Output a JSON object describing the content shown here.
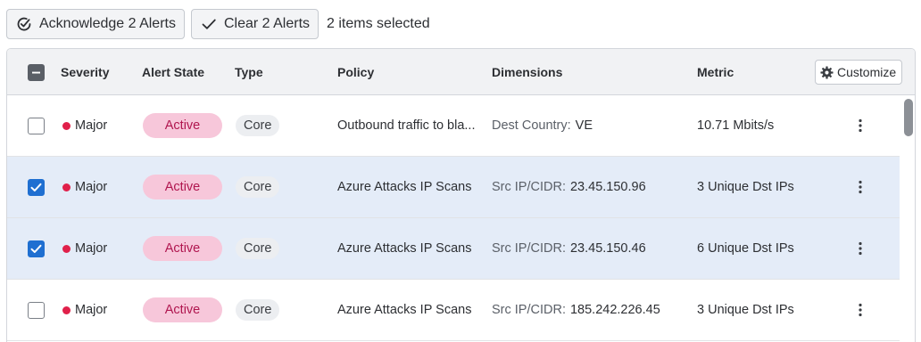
{
  "toolbar": {
    "acknowledge_label": "Acknowledge 2 Alerts",
    "clear_label": "Clear 2 Alerts",
    "selection_text": "2 items selected"
  },
  "table": {
    "columns": {
      "severity": "Severity",
      "alert_state": "Alert State",
      "type": "Type",
      "policy": "Policy",
      "dimensions": "Dimensions",
      "metric": "Metric"
    },
    "customize_label": "Customize",
    "header_checkbox_state": "partial",
    "rows": [
      {
        "selected": false,
        "severity": "Major",
        "state": "Active",
        "type": "Core",
        "policy": "Outbound traffic to bla...",
        "dim_label": "Dest Country:",
        "dim_value": "VE",
        "metric": "10.71 Mbits/s"
      },
      {
        "selected": true,
        "severity": "Major",
        "state": "Active",
        "type": "Core",
        "policy": "Azure Attacks IP Scans",
        "dim_label": "Src IP/CIDR:",
        "dim_value": "23.45.150.96",
        "metric": "3 Unique Dst IPs"
      },
      {
        "selected": true,
        "severity": "Major",
        "state": "Active",
        "type": "Core",
        "policy": "Azure Attacks IP Scans",
        "dim_label": "Src IP/CIDR:",
        "dim_value": "23.45.150.46",
        "metric": "6 Unique Dst IPs"
      },
      {
        "selected": false,
        "severity": "Major",
        "state": "Active",
        "type": "Core",
        "policy": "Azure Attacks IP Scans",
        "dim_label": "Src IP/CIDR:",
        "dim_value": "185.242.226.45",
        "metric": "3 Unique Dst IPs"
      }
    ]
  },
  "colors": {
    "accent": "#1f6fd1",
    "selected_row": "#e4ecf8",
    "severity_major": "#e0204a",
    "active_pill_bg": "#f7c7da",
    "active_pill_text": "#b0164f"
  },
  "icons": {
    "acknowledge": "circular-check-icon",
    "clear": "checkmark-icon",
    "customize": "gear-icon",
    "row_menu": "kebab-menu-icon"
  }
}
